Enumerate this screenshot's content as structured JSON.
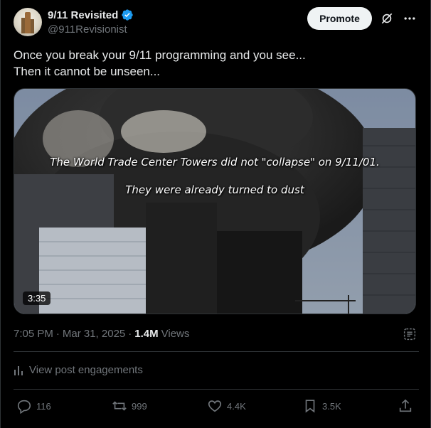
{
  "author": {
    "display_name": "9/11 Revisited",
    "handle": "@911Revisionist",
    "verified": true
  },
  "header": {
    "promote_label": "Promote",
    "grok_icon": "grok-icon",
    "more_icon": "more-icon"
  },
  "post": {
    "text_line1": "Once you break your 9/11 programming and you see...",
    "text_line2": "Then it cannot be unseen..."
  },
  "media": {
    "overlay_line1": "The World Trade Center Towers did not \"collapse\" on 9/11/01.",
    "overlay_line2": "They were already turned to dust",
    "duration": "3:35"
  },
  "meta": {
    "time": "7:05 PM",
    "sep1": "·",
    "date": "Mar 31, 2025",
    "sep2": "·",
    "views": "1.4M",
    "views_label": "Views"
  },
  "engagements_label": "View post engagements",
  "actions": {
    "replies": "116",
    "reposts": "999",
    "likes": "4.4K",
    "bookmarks": "3.5K"
  },
  "colors": {
    "background": "#000000",
    "text_primary": "#e7e9ea",
    "text_secondary": "#71767b",
    "verified": "#1d9bf0",
    "divider": "#2f3336"
  }
}
